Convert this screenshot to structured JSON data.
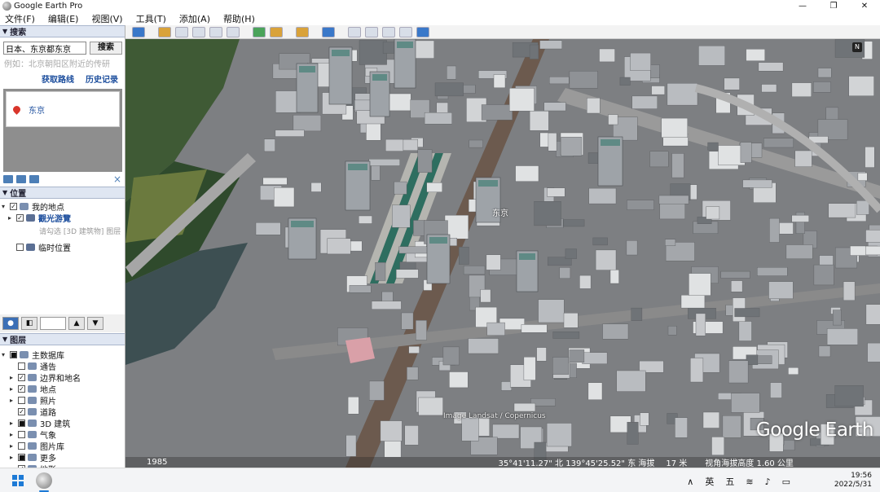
{
  "window": {
    "title": "Google Earth Pro",
    "controls": [
      "—",
      "❐",
      "✕"
    ]
  },
  "menu": [
    "文件(F)",
    "编辑(E)",
    "视图(V)",
    "工具(T)",
    "添加(A)",
    "帮助(H)"
  ],
  "search": {
    "panel_title": "搜索",
    "value": "日本、东京都东京",
    "button": "搜索",
    "hint": "例如：北京朝阳区附近的传研",
    "link_directions": "获取路线",
    "link_history": "历史记录",
    "result": "东京"
  },
  "places": {
    "panel_title": "位置",
    "my_places": "我的地点",
    "tour": "觀光游覽",
    "tour_hint": "请勾选 [3D 建筑物] 图层",
    "temp": "临时位置"
  },
  "layers": {
    "panel_title": "图层",
    "items": [
      "主数据库",
      "通告",
      "边界和地名",
      "地点",
      "照片",
      "道路",
      "3D 建筑",
      "气象",
      "图片库",
      "更多",
      "地形"
    ]
  },
  "map": {
    "compass": "N",
    "place_label": "东京",
    "credit": "Image Landsat / Copernicus",
    "logo": "Google Earth",
    "status_year": "1985",
    "status_coords": "35°41'11.27\" 北 139°45'25.52\" 东 海拔",
    "status_elev": "17 米",
    "status_eye": "视角海拔高度  1.60 公里"
  },
  "taskbar": {
    "tray_caret": "∧",
    "ime_lang": "英",
    "ime_mode": "五",
    "time": "19:56",
    "date": "2022/5/31"
  },
  "colors": {
    "accent": "#1d7ad6",
    "link": "#1a4c9c",
    "panel_head": "#dfe6f2"
  }
}
